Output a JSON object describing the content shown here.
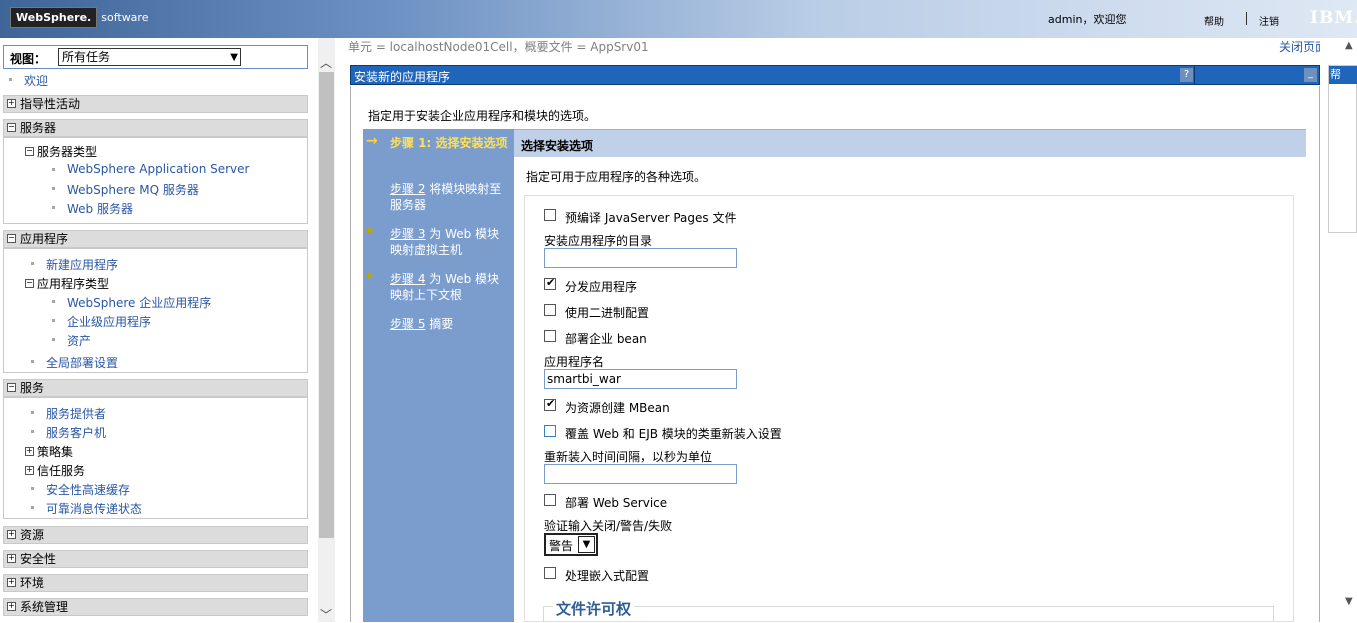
{
  "banner": {
    "logo_bold": "WebSphere.",
    "logo_light": "software",
    "user_greeting": "admin，欢迎您",
    "help": "帮助",
    "separator": "|",
    "logout": "注销",
    "ibm": "IBM."
  },
  "nav": {
    "view_label": "视图：",
    "view_value": "所有任务",
    "welcome": "欢迎",
    "sections": {
      "guided": "指导性活动",
      "servers": "服务器",
      "applications": "应用程序",
      "services": "服务",
      "resources": "资源",
      "security": "安全性",
      "environment": "环境",
      "system_admin": "系统管理"
    },
    "servers": {
      "server_types": "服务器类型",
      "items": [
        "WebSphere Application Server",
        "WebSphere MQ 服务器",
        "Web 服务器"
      ]
    },
    "applications": {
      "new_app": "新建应用程序",
      "app_types": "应用程序类型",
      "types": [
        "WebSphere 企业应用程序",
        "企业级应用程序",
        "资产"
      ],
      "global_deploy": "全局部署设置"
    },
    "services": {
      "providers": "服务提供者",
      "clients": "服务客户机",
      "policy_sets": "策略集",
      "trust_service": "信任服务",
      "security_cache": "安全性高速缓存",
      "reliable_messaging": "可靠消息传递状态"
    }
  },
  "main": {
    "breadcrumb": "单元 = localhostNode01Cell，概要文件 = AppSrv01",
    "close_page": "关闭页面",
    "panel_title": "安装新的应用程序",
    "help_q": "?",
    "minimize": "_",
    "intro": "指定用于安装企业应用程序和模块的选项。",
    "steps": [
      {
        "prefix": "步骤 1:",
        "text": " 选择安装选项"
      },
      {
        "prefix": "步骤 2",
        "text": " 将模块映射至服务器"
      },
      {
        "prefix": "步骤 3",
        "text": " 为 Web 模块映射虚拟主机"
      },
      {
        "prefix": "步骤 4",
        "text": " 为 Web 模块映射上下文根"
      },
      {
        "prefix": "步骤 5",
        "text": " 摘要"
      }
    ],
    "content_title": "选择安装选项",
    "content_desc": "指定可用于应用程序的各种选项。",
    "options": {
      "precompile_jsp": "预编译 JavaServer Pages 文件",
      "install_dir_label": "安装应用程序的目录",
      "install_dir_value": "",
      "distribute_app": "分发应用程序",
      "use_binary_config": "使用二进制配置",
      "deploy_ejb": "部署企业 bean",
      "app_name_label": "应用程序名",
      "app_name_value": "smartbi_war",
      "create_mbeans": "为资源创建 MBean",
      "override_reload": "覆盖 Web 和 EJB 模块的类重新装入设置",
      "reload_interval_label": "重新装入时间间隔，以秒为单位",
      "reload_interval_value": "",
      "deploy_webservice": "部署 Web Service",
      "validate_label": "验证输入关闭/警告/失败",
      "validate_value": "警告",
      "process_embedded": "处理嵌入式配置",
      "file_permission": "文件许可权"
    }
  },
  "right_panel": {
    "title": "帮"
  }
}
